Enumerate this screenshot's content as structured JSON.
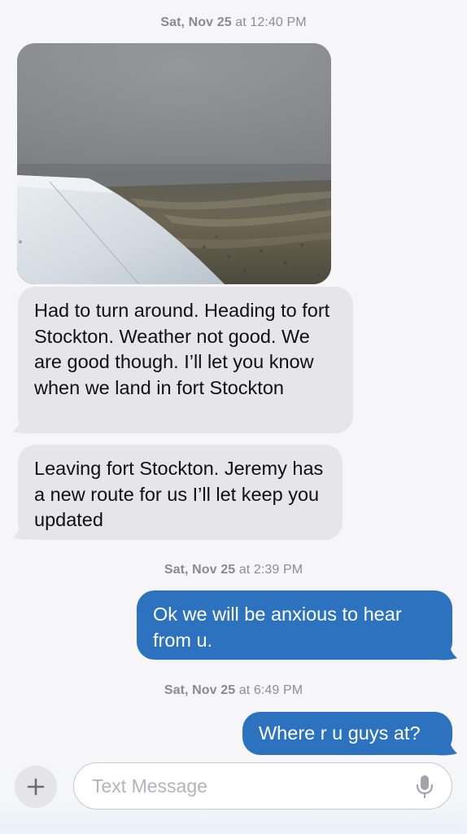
{
  "conversation": {
    "timestamps": [
      {
        "day": "Sat, Nov 25",
        "time": "at 12:40 PM"
      },
      {
        "day": "Sat, Nov 25",
        "time": "at 2:39 PM"
      },
      {
        "day": "Sat, Nov 25",
        "time": "at 6:49 PM"
      }
    ],
    "messages": [
      {
        "direction": "incoming",
        "type": "photo",
        "content": "airplane-wing-over-desert-photo"
      },
      {
        "direction": "incoming",
        "type": "text",
        "text": "Had to turn around. Heading to fort Stockton. Weather not good. We are good though. I’ll let you know when we land in fort Stockton"
      },
      {
        "direction": "incoming",
        "type": "text",
        "text": "Leaving fort Stockton. Jeremy has a new route for us I’ll let keep you updated"
      },
      {
        "direction": "outgoing",
        "type": "text",
        "text": "Ok we will be anxious to hear from u."
      },
      {
        "direction": "outgoing",
        "type": "text",
        "text": "Where r u guys at?"
      }
    ]
  },
  "composer": {
    "placeholder": "Text Message",
    "plus_icon": "plus-icon",
    "mic_icon": "microphone-icon"
  },
  "colors": {
    "background": "#f6f6f8",
    "incoming_bubble": "#e5e5ea",
    "outgoing_bubble": "#2c72be",
    "timestamp_text": "#8e8e93"
  }
}
